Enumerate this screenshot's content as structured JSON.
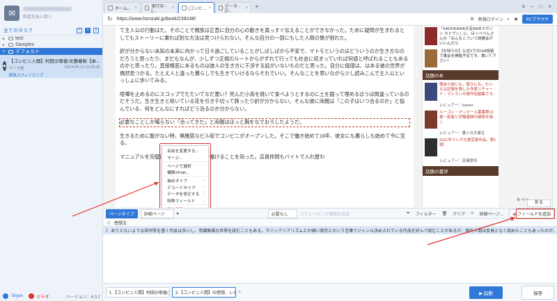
{
  "sidebar": {
    "login": "料金を払い戻く",
    "header": "全てのタスク",
    "folders": [
      {
        "label": "test"
      },
      {
        "label": "Samples"
      },
      {
        "label": "デフォルト"
      }
    ],
    "task": {
      "title": "【コンビニ人間】村田沙耶香/文藝春秋【本...",
      "type": "データ型",
      "date": "2024-05-10 11:29:36",
      "link": "簡易スクレイピング"
    },
    "bottom": {
      "skype": "Skype",
      "video": "ビデオ",
      "version": "バージョン：4.0.2"
    }
  },
  "tabs": [
    {
      "label": "ホーム..."
    },
    {
      "label": "実行中 - [..."
    },
    {
      "label": "[コンビ..."
    },
    {
      "label": "データ - [2..."
    }
  ],
  "urlbar": {
    "url": "https://www.honzuki.jp/book/239248/",
    "login": "新規ログイン",
    "browser": "PCブラウザ"
  },
  "article": {
    "paragraphs": [
      "て主人公の行動はた。そのことで親族は正直に自分の心の動きを真っすぐ伝えることができなかった。ために疑問が生まれるとしてもストーリーに乗れば別な方法は見つけられない。そんな自分の一部にもした人間の傷が割れた。",
      "訳が分からない未知の未来に向かって日々過ごしていることがしばしばから不安で、マトモというのはどういうのか生き方なのだろうと思ったり、まだもなんが、少しずつ正規のルートからがずれて行っても社会に収まっていれば何値と呼ばれることもあるのかと思ったり。直接根底にあるものは彼人の生き方に干渉する話がいないものだと思った。自分に価値は、はある彼の世界が偶然見つかる。たとえ人と違った暮らしでも生きていけるならそれでいい。そんなことを思いながら少し読みこんで主人公といっしょに歩いてみる。",
      "喧嘩を止めるのにスコップでたたいてなだ悪い？死んだ小鳥を焼いて食べようとするのに土を掘って埋めるほうは間違っているのだそうだ。生き生きと咲いている花を引き千切って飾ったり訳が分からない。そんな彼に両親は「この子はいつ治るのか」と悩んでいる、何をどんなにすればどう治るのか分からない。",
      "必要なことしか喋らない「治ってきた」と両親はほっと胸をなでおろしたようだ。",
      "生きるために服がない時、無機質なビル街でコンビニがオープンした。そこで働き始めて18年、彼女にも暮らしも始めて今に至る。",
      "マニュアルを完璧に使いこなして上手に働けることを知った。店員仲間もバイトで入れ替わ"
    ]
  },
  "side": {
    "ad_text": "「KADOKAWA文芸WEBマガジン カドブン」に、ほっぺぺんさんの「みんなこういう読書会がいいんだ!!」",
    "ad_text2": "【お知らせ】公式XでのGM投稿で書会を開催予定です。書いて下さい！",
    "section1": "話題の本",
    "books": [
      {
        "title": "僕自小説にも、使ひにも。たいなる記録を残した作家リチャード・マシスンの傑作短編集です。",
        "reviewer": "レビュアー：hacker"
      },
      {
        "title": "ルーゴン・マッカール叢書第13巻一若者と労働者間の関係を描く",
        "reviewer": "レビュアー：書ヶ丘文庫主"
      },
      {
        "title": "2021年マンガ大賞受賞作品、第1弾！",
        "reviewer": "レビュアー：涼澤慧冬"
      }
    ],
    "section2": "話題の書評"
  },
  "context_menu": [
    {
      "label": "名前を変更する..."
    },
    {
      "label": "マージ..."
    },
    {
      "label": "ページで選択"
    },
    {
      "label": "構築XPath..."
    },
    {
      "label": "抽出タイプ"
    },
    {
      "label": "デコードタイプ"
    },
    {
      "label": "データを修正する"
    },
    {
      "label": "特殊フィールド"
    },
    {
      "label": "列を削除"
    }
  ],
  "bottom_panel": {
    "preview_tab": "ページタイプ",
    "page_select": "詳細ページ",
    "need_select": "必要なし",
    "scrape_hint": "スクレイピング範囲を設定",
    "filter": "フィルター",
    "clear": "クリア",
    "detail_page": "詳細ページ...",
    "add_field": "フィールドを追加",
    "float_label": "ペー",
    "float_btn": "折る"
  },
  "grid": {
    "column": "感想文",
    "rows": [
      {
        "index": "1",
        "text": "ありえないような非同常を書く作品は多いし、常識無縁な世界を読むこともある。マジックリアリズムとか細い実存とかいう言葉でジャンル決めされている作品を好んで読むことがあるが、案外人間は反発となく読めたこともあったのが、"
      }
    ]
  },
  "footer": {
    "tabs": [
      {
        "label": "1.【コンビニ人間】村田沙耶香/文藝..."
      },
      {
        "label": "2.【コンビニ人間】の感想、レビ..."
      }
    ],
    "start": "起動",
    "save": "保存"
  }
}
